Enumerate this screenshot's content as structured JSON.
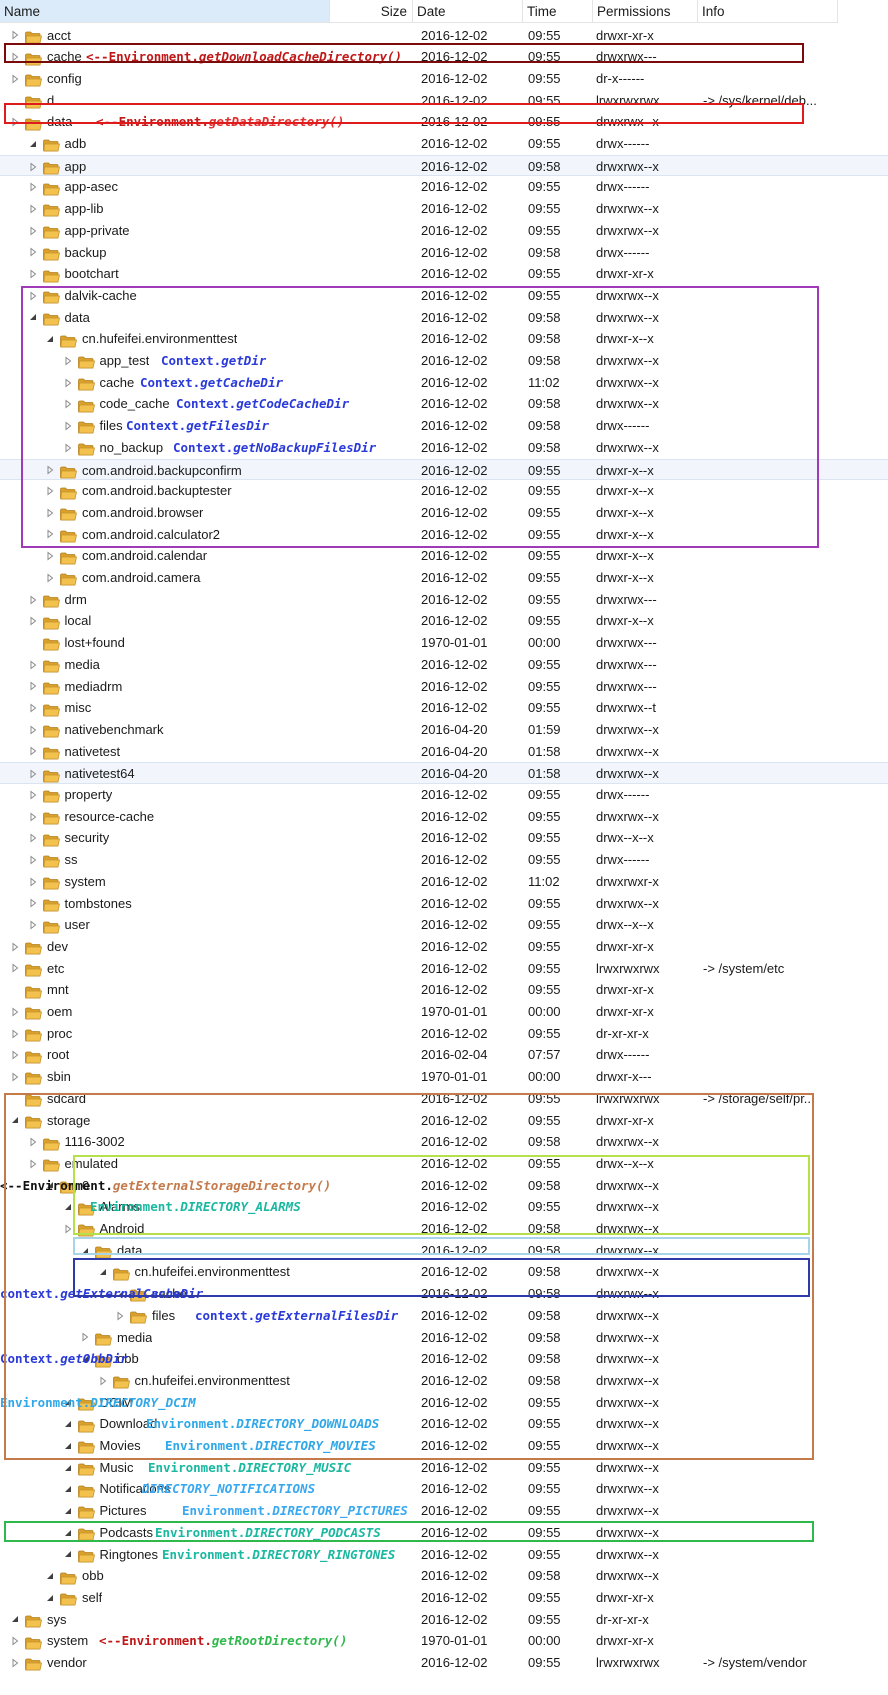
{
  "header": {
    "name": "Name",
    "size": "Size",
    "date": "Date",
    "time": "Time",
    "permissions": "Permissions",
    "info": "Info"
  },
  "colors": {
    "cache_box": "#7b0b0b",
    "data_box": "#e01b1b",
    "app_data_box": "#a03ab8",
    "external_box": "#c47a4a",
    "android_data_box": "#b5e04a",
    "media_box": "#a8d4ea",
    "obb_box": "#2e3aa8",
    "root_box": "#2fb84c",
    "annotation_dark": "#c01818",
    "annotation_blue": "#2a3ad8",
    "annotation_teal": "#1ab8a0",
    "annotation_cyan": "#30a8e8",
    "annotation_sky": "#38a8f0",
    "folder_fill": "#f2c14e",
    "selection": "#f2f6fc"
  },
  "rows": [
    {
      "name": "acct",
      "date": "2016-12-02",
      "time": "09:55",
      "perm": "drwxr-xr-x",
      "info": ""
    },
    {
      "name": "cache",
      "date": "2016-12-02",
      "time": "09:55",
      "perm": "drwxrwx---",
      "info": "",
      "ann": {
        "pre": "<--Environment.",
        "method": "getDownloadCacheDirectory()",
        "pre_color": "#c01818",
        "method_color": "#c01818"
      }
    },
    {
      "name": "config",
      "date": "2016-12-02",
      "time": "09:55",
      "perm": "dr-x------",
      "info": ""
    },
    {
      "name": "d",
      "date": "2016-12-02",
      "time": "09:55",
      "perm": "lrwxrwxrwx",
      "info": "-> /sys/kernel/deb..."
    },
    {
      "name": "data",
      "date": "2016-12-02",
      "time": "09:55",
      "perm": "drwxrwx--x",
      "info": "",
      "ann": {
        "pre": "<--Environment.",
        "method": "getDataDirectory()",
        "pre_color": "#c01818",
        "method_color": "#e03030"
      }
    },
    {
      "name": "adb",
      "date": "2016-12-02",
      "time": "09:55",
      "perm": "drwx------",
      "info": ""
    },
    {
      "name": "app",
      "date": "2016-12-02",
      "time": "09:58",
      "perm": "drwxrwx--x",
      "info": ""
    },
    {
      "name": "app-asec",
      "date": "2016-12-02",
      "time": "09:55",
      "perm": "drwx------",
      "info": ""
    },
    {
      "name": "app-lib",
      "date": "2016-12-02",
      "time": "09:55",
      "perm": "drwxrwx--x",
      "info": ""
    },
    {
      "name": "app-private",
      "date": "2016-12-02",
      "time": "09:55",
      "perm": "drwxrwx--x",
      "info": ""
    },
    {
      "name": "backup",
      "date": "2016-12-02",
      "time": "09:58",
      "perm": "drwx------",
      "info": ""
    },
    {
      "name": "bootchart",
      "date": "2016-12-02",
      "time": "09:55",
      "perm": "drwxr-xr-x",
      "info": ""
    },
    {
      "name": "dalvik-cache",
      "date": "2016-12-02",
      "time": "09:55",
      "perm": "drwxrwx--x",
      "info": ""
    },
    {
      "name": "data",
      "date": "2016-12-02",
      "time": "09:58",
      "perm": "drwxrwx--x",
      "info": ""
    },
    {
      "name": "cn.hufeifei.environmenttest",
      "date": "2016-12-02",
      "time": "09:58",
      "perm": "drwxr-x--x",
      "info": ""
    },
    {
      "name": "app_test",
      "date": "2016-12-02",
      "time": "09:58",
      "perm": "drwxrwx--x",
      "info": "",
      "ann": {
        "pre": "Context.",
        "method": "getDir",
        "pre_color": "#2a3ad8",
        "method_color": "#2a3ad8"
      }
    },
    {
      "name": "cache",
      "date": "2016-12-02",
      "time": "11:02",
      "perm": "drwxrwx--x",
      "info": "",
      "ann": {
        "pre": "Context.",
        "method": "getCacheDir",
        "pre_color": "#2a3ad8",
        "method_color": "#2a3ad8"
      }
    },
    {
      "name": "code_cache",
      "date": "2016-12-02",
      "time": "09:58",
      "perm": "drwxrwx--x",
      "info": "",
      "ann": {
        "pre": "Context.",
        "method": "getCodeCacheDir",
        "pre_color": "#2a3ad8",
        "method_color": "#2a3ad8"
      }
    },
    {
      "name": "files",
      "date": "2016-12-02",
      "time": "09:58",
      "perm": "drwx------",
      "info": "",
      "ann": {
        "pre": "Context.",
        "method": "getFilesDir",
        "pre_color": "#2a3ad8",
        "method_color": "#2a3ad8"
      }
    },
    {
      "name": "no_backup",
      "date": "2016-12-02",
      "time": "09:58",
      "perm": "drwxrwx--x",
      "info": "",
      "ann": {
        "pre": "Context.",
        "method": "getNoBackupFilesDir",
        "pre_color": "#2a3ad8",
        "method_color": "#2a3ad8"
      }
    },
    {
      "name": "com.android.backupconfirm",
      "date": "2016-12-02",
      "time": "09:55",
      "perm": "drwxr-x--x",
      "info": ""
    },
    {
      "name": "com.android.backuptester",
      "date": "2016-12-02",
      "time": "09:55",
      "perm": "drwxr-x--x",
      "info": ""
    },
    {
      "name": "com.android.browser",
      "date": "2016-12-02",
      "time": "09:55",
      "perm": "drwxr-x--x",
      "info": ""
    },
    {
      "name": "com.android.calculator2",
      "date": "2016-12-02",
      "time": "09:55",
      "perm": "drwxr-x--x",
      "info": ""
    },
    {
      "name": "com.android.calendar",
      "date": "2016-12-02",
      "time": "09:55",
      "perm": "drwxr-x--x",
      "info": ""
    },
    {
      "name": "com.android.camera",
      "date": "2016-12-02",
      "time": "09:55",
      "perm": "drwxr-x--x",
      "info": ""
    },
    {
      "name": "drm",
      "date": "2016-12-02",
      "time": "09:55",
      "perm": "drwxrwx---",
      "info": ""
    },
    {
      "name": "local",
      "date": "2016-12-02",
      "time": "09:55",
      "perm": "drwxr-x--x",
      "info": ""
    },
    {
      "name": "lost+found",
      "date": "1970-01-01",
      "time": "00:00",
      "perm": "drwxrwx---",
      "info": ""
    },
    {
      "name": "media",
      "date": "2016-12-02",
      "time": "09:55",
      "perm": "drwxrwx---",
      "info": ""
    },
    {
      "name": "mediadrm",
      "date": "2016-12-02",
      "time": "09:55",
      "perm": "drwxrwx---",
      "info": ""
    },
    {
      "name": "misc",
      "date": "2016-12-02",
      "time": "09:55",
      "perm": "drwxrwx--t",
      "info": ""
    },
    {
      "name": "nativebenchmark",
      "date": "2016-04-20",
      "time": "01:59",
      "perm": "drwxrwx--x",
      "info": ""
    },
    {
      "name": "nativetest",
      "date": "2016-04-20",
      "time": "01:58",
      "perm": "drwxrwx--x",
      "info": ""
    },
    {
      "name": "nativetest64",
      "date": "2016-04-20",
      "time": "01:58",
      "perm": "drwxrwx--x",
      "info": ""
    },
    {
      "name": "property",
      "date": "2016-12-02",
      "time": "09:55",
      "perm": "drwx------",
      "info": ""
    },
    {
      "name": "resource-cache",
      "date": "2016-12-02",
      "time": "09:55",
      "perm": "drwxrwx--x",
      "info": ""
    },
    {
      "name": "security",
      "date": "2016-12-02",
      "time": "09:55",
      "perm": "drwx--x--x",
      "info": ""
    },
    {
      "name": "ss",
      "date": "2016-12-02",
      "time": "09:55",
      "perm": "drwx------",
      "info": ""
    },
    {
      "name": "system",
      "date": "2016-12-02",
      "time": "11:02",
      "perm": "drwxrwxr-x",
      "info": ""
    },
    {
      "name": "tombstones",
      "date": "2016-12-02",
      "time": "09:55",
      "perm": "drwxrwx--x",
      "info": ""
    },
    {
      "name": "user",
      "date": "2016-12-02",
      "time": "09:55",
      "perm": "drwx--x--x",
      "info": ""
    },
    {
      "name": "dev",
      "date": "2016-12-02",
      "time": "09:55",
      "perm": "drwxr-xr-x",
      "info": ""
    },
    {
      "name": "etc",
      "date": "2016-12-02",
      "time": "09:55",
      "perm": "lrwxrwxrwx",
      "info": "-> /system/etc"
    },
    {
      "name": "mnt",
      "date": "2016-12-02",
      "time": "09:55",
      "perm": "drwxr-xr-x",
      "info": ""
    },
    {
      "name": "oem",
      "date": "1970-01-01",
      "time": "00:00",
      "perm": "drwxr-xr-x",
      "info": ""
    },
    {
      "name": "proc",
      "date": "2016-12-02",
      "time": "09:55",
      "perm": "dr-xr-xr-x",
      "info": ""
    },
    {
      "name": "root",
      "date": "2016-02-04",
      "time": "07:57",
      "perm": "drwx------",
      "info": ""
    },
    {
      "name": "sbin",
      "date": "1970-01-01",
      "time": "00:00",
      "perm": "drwxr-x---",
      "info": ""
    },
    {
      "name": "sdcard",
      "date": "2016-12-02",
      "time": "09:55",
      "perm": "lrwxrwxrwx",
      "info": "-> /storage/self/pr..."
    },
    {
      "name": "storage",
      "date": "2016-12-02",
      "time": "09:55",
      "perm": "drwxr-xr-x",
      "info": ""
    },
    {
      "name": "1116-3002",
      "date": "2016-12-02",
      "time": "09:58",
      "perm": "drwxrwx--x",
      "info": ""
    },
    {
      "name": "emulated",
      "date": "2016-12-02",
      "time": "09:55",
      "perm": "drwx--x--x",
      "info": ""
    },
    {
      "name": "0",
      "date": "2016-12-02",
      "time": "09:58",
      "perm": "drwxrwx--x",
      "info": "",
      "ann": {
        "pre": "<--Environment.",
        "method": "getExternalStorageDirectory()",
        "pre_color": "#111111",
        "method_color": "#c47a4a"
      }
    },
    {
      "name": "Alarms",
      "date": "2016-12-02",
      "time": "09:55",
      "perm": "drwxrwx--x",
      "info": "",
      "ann": {
        "pre": "Environment.",
        "method": "DIRECTORY_ALARMS",
        "pre_color": "#1ab8a0",
        "method_color": "#1ab8a0"
      }
    },
    {
      "name": "Android",
      "date": "2016-12-02",
      "time": "09:58",
      "perm": "drwxrwx--x",
      "info": ""
    },
    {
      "name": "data",
      "date": "2016-12-02",
      "time": "09:58",
      "perm": "drwxrwx--x",
      "info": ""
    },
    {
      "name": "cn.hufeifei.environmenttest",
      "date": "2016-12-02",
      "time": "09:58",
      "perm": "drwxrwx--x",
      "info": ""
    },
    {
      "name": "cache",
      "date": "2016-12-02",
      "time": "09:58",
      "perm": "drwxrwx--x",
      "info": "",
      "ann": {
        "pre": "context.",
        "method": "getExternalCacheDir",
        "pre_color": "#2a3ad8",
        "method_color": "#2a3ad8"
      }
    },
    {
      "name": "files",
      "date": "2016-12-02",
      "time": "09:58",
      "perm": "drwxrwx--x",
      "info": "",
      "ann": {
        "pre": "context.",
        "method": "getExternalFilesDir",
        "pre_color": "#2a3ad8",
        "method_color": "#2a3ad8"
      }
    },
    {
      "name": "media",
      "date": "2016-12-02",
      "time": "09:58",
      "perm": "drwxrwx--x",
      "info": ""
    },
    {
      "name": "obb",
      "date": "2016-12-02",
      "time": "09:58",
      "perm": "drwxrwx--x",
      "info": "",
      "ann": {
        "pre": "Context.",
        "method": "getObbDir",
        "pre_color": "#2a3ad8",
        "method_color": "#2a3ad8"
      }
    },
    {
      "name": "cn.hufeifei.environmenttest",
      "date": "2016-12-02",
      "time": "09:58",
      "perm": "drwxrwx--x",
      "info": ""
    },
    {
      "name": "DCIM",
      "date": "2016-12-02",
      "time": "09:55",
      "perm": "drwxrwx--x",
      "info": "",
      "ann": {
        "pre": "Environment.",
        "method": "DIRECTORY_DCIM",
        "pre_color": "#30a8e8",
        "method_color": "#30a8e8"
      }
    },
    {
      "name": "Download",
      "date": "2016-12-02",
      "time": "09:55",
      "perm": "drwxrwx--x",
      "info": "",
      "ann": {
        "pre": "Environment.",
        "method": "DIRECTORY_DOWNLOADS",
        "pre_color": "#30a8e8",
        "method_color": "#30a8e8"
      }
    },
    {
      "name": "Movies",
      "date": "2016-12-02",
      "time": "09:55",
      "perm": "drwxrwx--x",
      "info": "",
      "ann": {
        "pre": "Environment.",
        "method": "DIRECTORY_MOVIES",
        "pre_color": "#30a8e8",
        "method_color": "#30a8e8"
      }
    },
    {
      "name": "Music",
      "date": "2016-12-02",
      "time": "09:55",
      "perm": "drwxrwx--x",
      "info": "",
      "ann": {
        "pre": "Environment.",
        "method": "DIRECTORY_MUSIC",
        "pre_color": "#1ab8a0",
        "method_color": "#1ab8a0"
      }
    },
    {
      "name": "Notifications",
      "date": "2016-12-02",
      "time": "09:55",
      "perm": "drwxrwx--x",
      "info": "",
      "ann": {
        "pre": "",
        "method": "DIRECTORY_NOTIFICATIONS",
        "pre_color": "#38a8f0",
        "method_color": "#38a8f0"
      }
    },
    {
      "name": "Pictures",
      "date": "2016-12-02",
      "time": "09:55",
      "perm": "drwxrwx--x",
      "info": "",
      "ann": {
        "pre": "Environment.",
        "method": "DIRECTORY_PICTURES",
        "pre_color": "#38a8f0",
        "method_color": "#38a8f0"
      }
    },
    {
      "name": "Podcasts",
      "date": "2016-12-02",
      "time": "09:55",
      "perm": "drwxrwx--x",
      "info": "",
      "ann": {
        "pre": "Environment.",
        "method": "DIRECTORY_PODCASTS",
        "pre_color": "#1ab8a0",
        "method_color": "#1ab8a0"
      }
    },
    {
      "name": "Ringtones",
      "date": "2016-12-02",
      "time": "09:55",
      "perm": "drwxrwx--x",
      "info": "",
      "ann": {
        "pre": "Environment.",
        "method": "DIRECTORY_RINGTONES",
        "pre_color": "#1ab8a0",
        "method_color": "#1ab8a0"
      }
    },
    {
      "name": "obb",
      "date": "2016-12-02",
      "time": "09:58",
      "perm": "drwxrwx--x",
      "info": ""
    },
    {
      "name": "self",
      "date": "2016-12-02",
      "time": "09:55",
      "perm": "drwxr-xr-x",
      "info": ""
    },
    {
      "name": "sys",
      "date": "2016-12-02",
      "time": "09:55",
      "perm": "dr-xr-xr-x",
      "info": ""
    },
    {
      "name": "system",
      "date": "1970-01-01",
      "time": "00:00",
      "perm": "drwxr-xr-x",
      "info": "",
      "ann": {
        "pre": "<--Environment.",
        "method": "getRootDirectory()",
        "pre_color": "#c01818",
        "method_color": "#2fb84c"
      }
    },
    {
      "name": "vendor",
      "date": "2016-12-02",
      "time": "09:55",
      "perm": "lrwxrwxrwx",
      "info": "-> /system/vendor"
    }
  ]
}
